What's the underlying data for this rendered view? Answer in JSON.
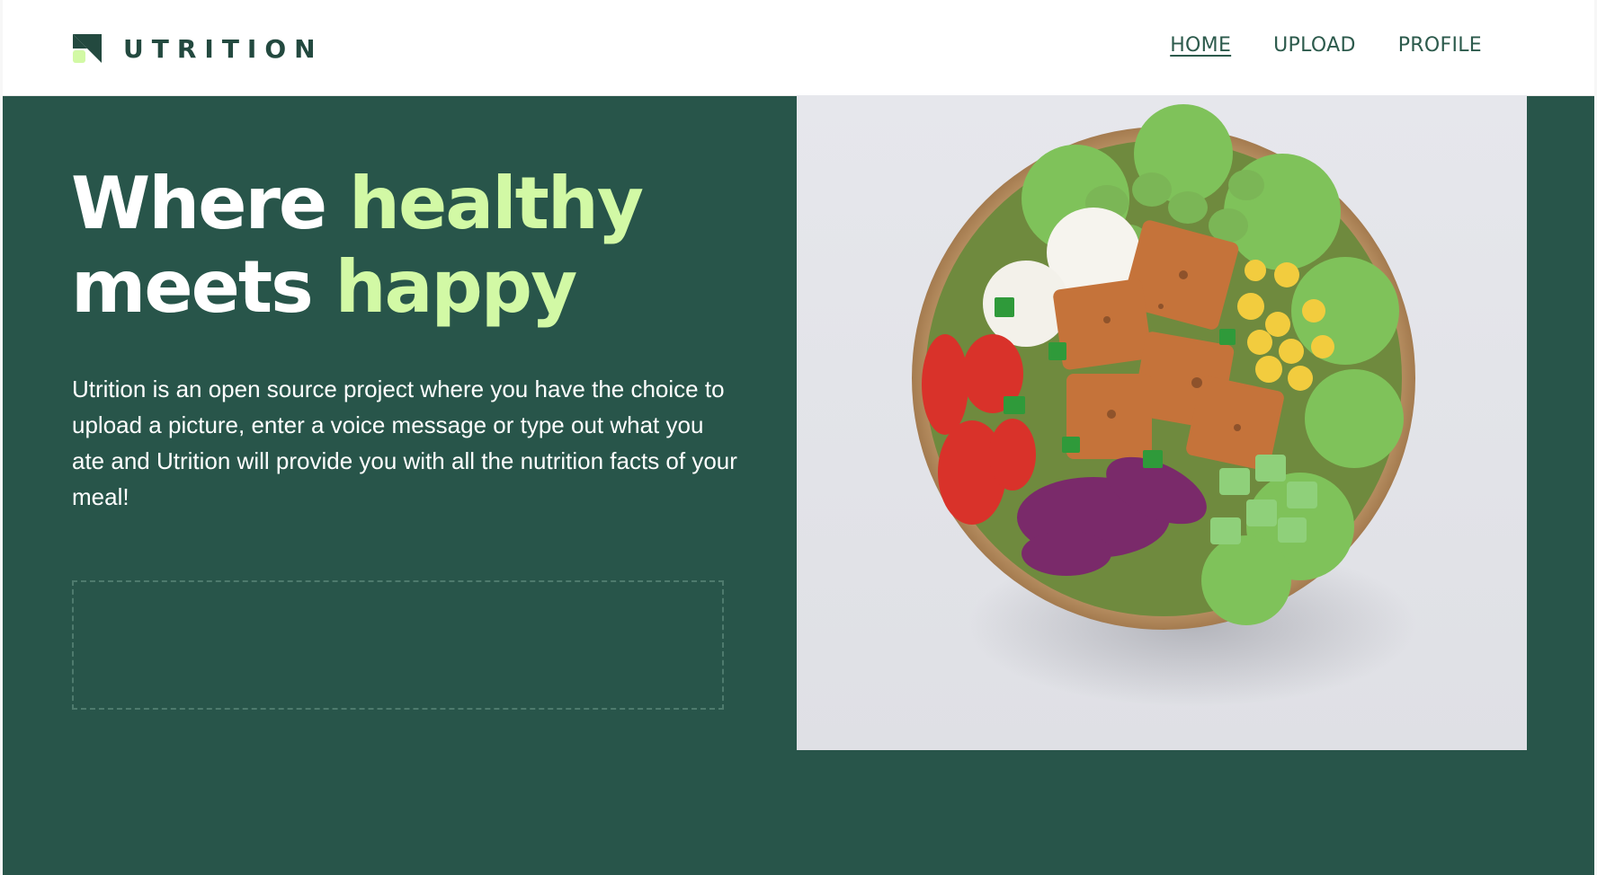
{
  "header": {
    "brand": "UTRITION",
    "nav": [
      {
        "label": "HOME",
        "active": true
      },
      {
        "label": "UPLOAD",
        "active": false
      },
      {
        "label": "PROFILE",
        "active": false
      }
    ]
  },
  "hero": {
    "headline": {
      "part1": "Where ",
      "accent1": "healthy",
      "part2": "meets ",
      "accent2": "happy"
    },
    "intro": "Utrition is an open source project where you have the choice to upload a picture, enter a voice message or type out what you ate and Utrition will provide you with all the nutrition facts of your meal!",
    "image": "salad-bowl-photo"
  },
  "colors": {
    "brand_dark": "#28554a",
    "accent_green": "#d2f9a5",
    "header_bg": "#ffffff",
    "text_white": "#ffffff"
  }
}
